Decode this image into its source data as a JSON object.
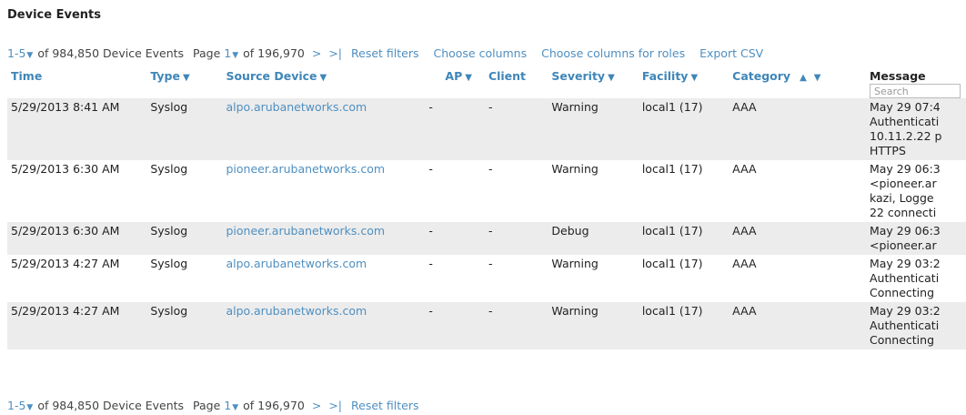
{
  "page": {
    "title": "Device Events"
  },
  "pager_top": {
    "range": "1-5",
    "count_text": "of 984,850 Device Events",
    "page_label": "Page",
    "page_number": "1",
    "of_pages": "of 196,970",
    "next": ">",
    "last": ">|",
    "reset": "Reset filters",
    "choose_columns": "Choose columns",
    "choose_columns_roles": "Choose columns for roles",
    "export_csv": "Export CSV"
  },
  "pager_bottom": {
    "range": "1-5",
    "count_text": "of 984,850 Device Events",
    "page_label": "Page",
    "page_number": "1",
    "of_pages": "of 196,970",
    "next": ">",
    "last": ">|",
    "reset": "Reset filters"
  },
  "columns": {
    "time": "Time",
    "type": "Type",
    "source": "Source Device",
    "ap": "AP",
    "client": "Client",
    "severity": "Severity",
    "facility": "Facility",
    "category": "Category",
    "message": "Message",
    "sort_indicator": "▲",
    "filter_icon": "filter-funnel-icon",
    "search_placeholder": "Search"
  },
  "rows": [
    {
      "time": "5/29/2013 8:41 AM",
      "type": "Syslog",
      "source": "alpo.arubanetworks.com",
      "ap": "-",
      "client": "-",
      "severity": "Warning",
      "facility": "local1 (17)",
      "category": "AAA",
      "message": [
        "May 29 07:4",
        "Authenticati",
        "10.11.2.22 p",
        "HTTPS"
      ]
    },
    {
      "time": "5/29/2013 6:30 AM",
      "type": "Syslog",
      "source": "pioneer.arubanetworks.com",
      "ap": "-",
      "client": "-",
      "severity": "Warning",
      "facility": "local1 (17)",
      "category": "AAA",
      "message": [
        "May 29 06:3",
        "<pioneer.ar",
        "kazi, Logge",
        "22 connecti"
      ]
    },
    {
      "time": "5/29/2013 6:30 AM",
      "type": "Syslog",
      "source": "pioneer.arubanetworks.com",
      "ap": "-",
      "client": "-",
      "severity": "Debug",
      "facility": "local1 (17)",
      "category": "AAA",
      "message": [
        "May 29 06:3",
        "<pioneer.ar"
      ]
    },
    {
      "time": "5/29/2013 4:27 AM",
      "type": "Syslog",
      "source": "alpo.arubanetworks.com",
      "ap": "-",
      "client": "-",
      "severity": "Warning",
      "facility": "local1 (17)",
      "category": "AAA",
      "message": [
        "May 29 03:2",
        "Authenticati",
        "Connecting"
      ]
    },
    {
      "time": "5/29/2013 4:27 AM",
      "type": "Syslog",
      "source": "alpo.arubanetworks.com",
      "ap": "-",
      "client": "-",
      "severity": "Warning",
      "facility": "local1 (17)",
      "category": "AAA",
      "message": [
        "May 29 03:2",
        "Authenticati",
        "Connecting"
      ]
    }
  ]
}
